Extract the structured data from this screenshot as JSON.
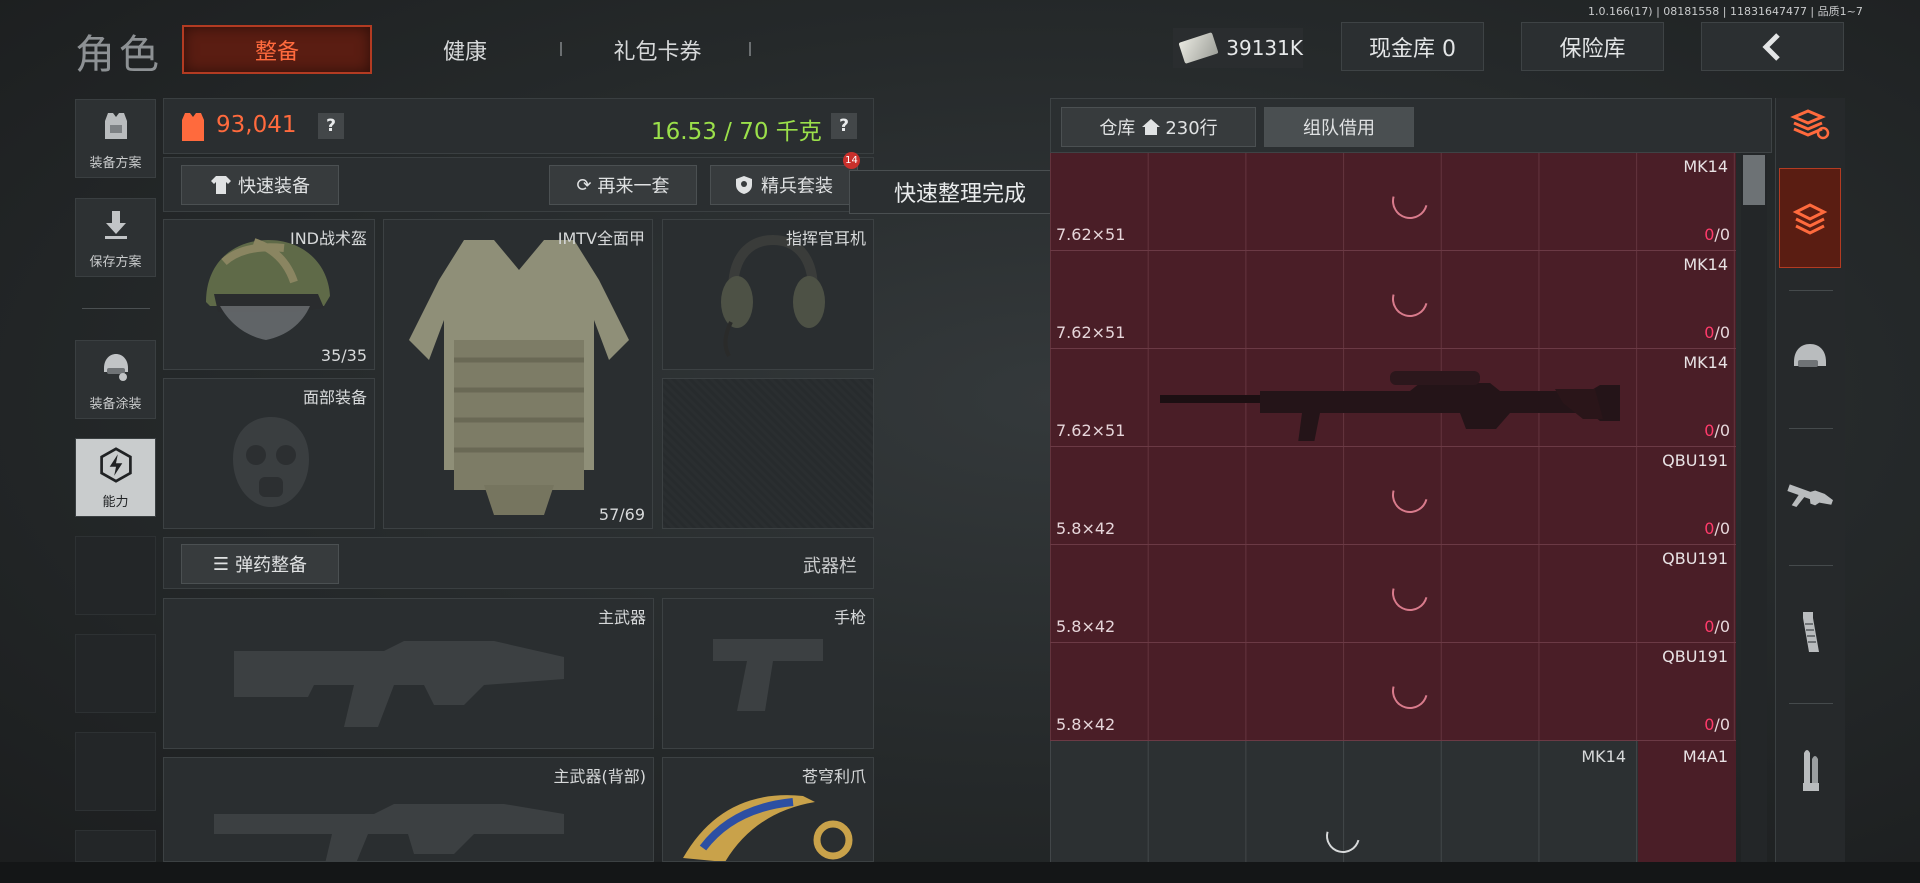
{
  "header": {
    "title": "角色",
    "tabs": [
      {
        "label": "整备",
        "active": true
      },
      {
        "label": "健康",
        "active": false
      },
      {
        "label": "礼包卡券",
        "active": false
      }
    ],
    "version": "1.0.166(17) | 08181558 | 11831647477 | 品质1~7",
    "money": "39131K",
    "cash_vault": "现金库 0",
    "safe_vault": "保险库",
    "back_icon": "chevron-left-icon"
  },
  "left_rail": [
    {
      "label": "装备方案",
      "icon": "vest-icon"
    },
    {
      "label": "保存方案",
      "icon": "download-icon"
    },
    {
      "label": "装备涂装",
      "icon": "helmet-skin-icon"
    },
    {
      "label": "能力",
      "icon": "lightning-badge-icon",
      "active": true
    }
  ],
  "gear": {
    "value": "93,041",
    "weight": "16.53 / 70 千克",
    "help": "?",
    "quick_equip": "快速装备",
    "again_set": "再来一套",
    "elite_set": "精兵套装",
    "elite_badge": "14",
    "helmet": {
      "name": "IND战术盔",
      "durability": "35/35"
    },
    "armor": {
      "name": "IMTV全面甲",
      "durability": "57/69"
    },
    "headset": {
      "name": "指挥官耳机"
    },
    "face": {
      "name": "面部装备"
    }
  },
  "weapons": {
    "ammo_sort": "弹药整备",
    "bar_label": "武器栏",
    "primary": "主武器",
    "pistol": "手枪",
    "primary_back": "主武器(背部)",
    "melee": "苍穹利爪"
  },
  "tooltip": "快速整理完成",
  "warehouse": {
    "title": "仓库",
    "rows_count": "230行",
    "team_borrow": "组队借用",
    "rows": [
      {
        "name": "MK14",
        "caliber": "7.62×51",
        "ammo_current": "0",
        "ammo_max": "/0"
      },
      {
        "name": "MK14",
        "caliber": "7.62×51",
        "ammo_current": "0",
        "ammo_max": "/0"
      },
      {
        "name": "MK14",
        "caliber": "7.62×51",
        "ammo_current": "0",
        "ammo_max": "/0"
      },
      {
        "name": "QBU191",
        "caliber": "5.8×42",
        "ammo_current": "0",
        "ammo_max": "/0"
      },
      {
        "name": "QBU191",
        "caliber": "5.8×42",
        "ammo_current": "0",
        "ammo_max": "/0"
      },
      {
        "name": "QBU191",
        "caliber": "5.8×42",
        "ammo_current": "0",
        "ammo_max": "/0"
      }
    ],
    "bottom_left": "MK14",
    "bottom_right": "M4A1"
  },
  "category_rail": [
    "sort-layers-icon",
    "all-items-icon",
    "helmet-icon",
    "rifle-icon",
    "magazine-icon",
    "bullet-icon"
  ],
  "colors": {
    "accent": "#ff6a3d",
    "weight": "#9be04a",
    "ammo_zero": "#ff3b6b",
    "row_bg": "#4a1e27"
  }
}
